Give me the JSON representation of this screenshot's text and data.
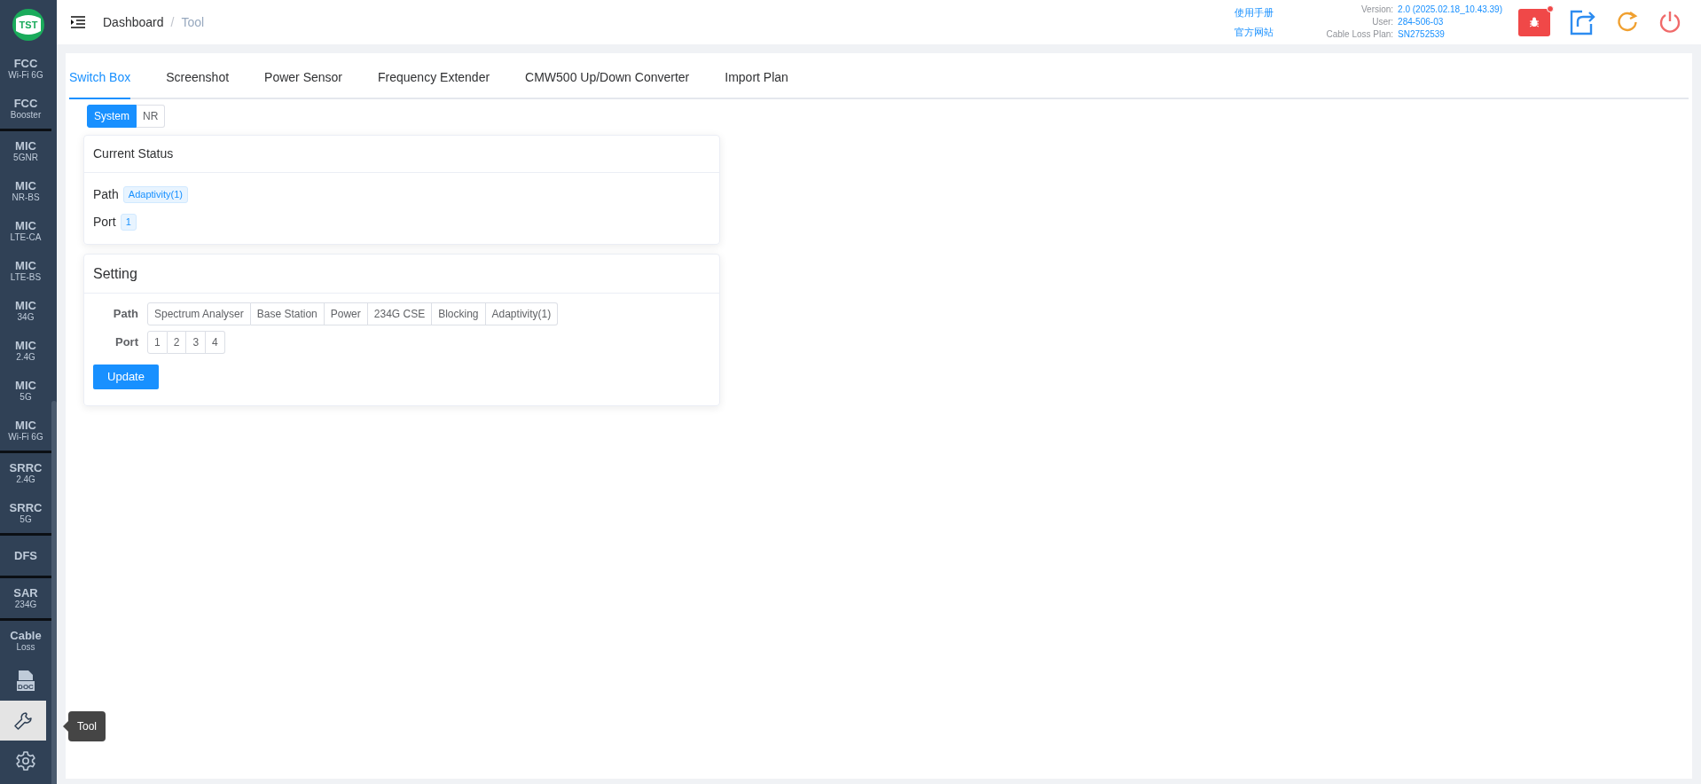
{
  "sidebar": {
    "logo": "TST",
    "groups": [
      {
        "items": [
          {
            "title": "FCC",
            "subtitle": "Wi-Fi 6G"
          },
          {
            "title": "FCC",
            "subtitle": "Booster"
          }
        ]
      },
      {
        "items": [
          {
            "title": "MIC",
            "subtitle": "5GNR"
          },
          {
            "title": "MIC",
            "subtitle": "NR-BS"
          },
          {
            "title": "MIC",
            "subtitle": "LTE-CA"
          },
          {
            "title": "MIC",
            "subtitle": "LTE-BS"
          },
          {
            "title": "MIC",
            "subtitle": "34G"
          },
          {
            "title": "MIC",
            "subtitle": "2.4G"
          },
          {
            "title": "MIC",
            "subtitle": "5G"
          },
          {
            "title": "MIC",
            "subtitle": "Wi-Fi 6G"
          }
        ]
      },
      {
        "items": [
          {
            "title": "SRRC",
            "subtitle": "2.4G"
          },
          {
            "title": "SRRC",
            "subtitle": "5G"
          }
        ]
      },
      {
        "items": [
          {
            "title": "DFS"
          }
        ]
      },
      {
        "items": [
          {
            "title": "SAR",
            "subtitle": "234G"
          }
        ]
      },
      {
        "items": [
          {
            "title": "Cable",
            "subtitle": "Loss"
          }
        ]
      }
    ],
    "icon_items": [
      {
        "kind": "doc",
        "selected": false,
        "icon_text": "DOC"
      },
      {
        "kind": "tool",
        "selected": true,
        "tooltip": "Tool"
      },
      {
        "kind": "settings",
        "selected": false
      }
    ]
  },
  "header": {
    "breadcrumb": [
      "Dashboard",
      "Tool"
    ],
    "breadcrumb_separator": "/",
    "links": [
      "使用手册",
      "官方网站"
    ],
    "info": [
      {
        "label": "Version:",
        "value": "2.0 (2025.02.18_10.43.39)"
      },
      {
        "label": "User:",
        "value": "284-506-03"
      },
      {
        "label": "Cable Loss Plan:",
        "value": "SN2752539"
      }
    ],
    "bug_button": {
      "notification": true
    }
  },
  "tabs": [
    {
      "label": "Switch Box",
      "selected": true
    },
    {
      "label": "Screenshot",
      "selected": false
    },
    {
      "label": "Power Sensor",
      "selected": false
    },
    {
      "label": "Frequency Extender",
      "selected": false
    },
    {
      "label": "CMW500 Up/Down Converter",
      "selected": false
    },
    {
      "label": "Import Plan",
      "selected": false
    }
  ],
  "subtabs": [
    {
      "label": "System",
      "selected": true
    },
    {
      "label": "NR",
      "selected": false
    }
  ],
  "current_status": {
    "title": "Current Status",
    "rows": [
      {
        "label": "Path",
        "value": "Adaptivity(1)"
      },
      {
        "label": "Port",
        "value": "1"
      }
    ]
  },
  "setting": {
    "title": "Setting",
    "rows": [
      {
        "label": "Path",
        "options": [
          {
            "label": "Spectrum Analyser",
            "selected": false
          },
          {
            "label": "Base Station",
            "selected": false
          },
          {
            "label": "Power",
            "selected": false
          },
          {
            "label": "234G CSE",
            "selected": false
          },
          {
            "label": "Blocking",
            "selected": false
          },
          {
            "label": "Adaptivity(1)",
            "selected": false
          }
        ]
      },
      {
        "label": "Port",
        "options": [
          {
            "label": "1",
            "selected": false
          },
          {
            "label": "2",
            "selected": false
          },
          {
            "label": "3",
            "selected": false
          },
          {
            "label": "4",
            "selected": false
          }
        ]
      }
    ],
    "button": "Update"
  }
}
